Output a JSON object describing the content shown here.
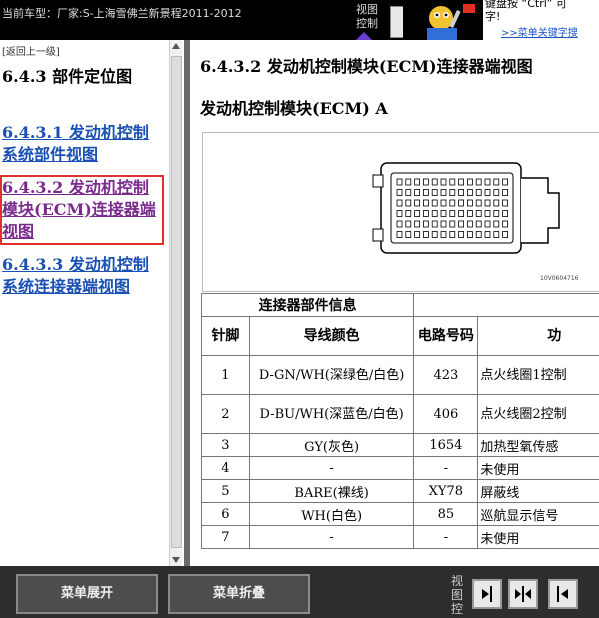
{
  "topbar": {
    "car_label": "当前车型：厂家:S-上海雪佛兰新景程2011-2012",
    "view_control": "视图控制",
    "help_line1": "键盘按 “Ctrl” 可",
    "help_line2": "字!",
    "help_link": ">>菜单关键字搜"
  },
  "left": {
    "back": "[返回上一级]",
    "section_title": "6.4.3 部件定位图",
    "links": [
      {
        "label": "6.4.3.1 发动机控制系统部件视图"
      },
      {
        "label": "6.4.3.2 发动机控制模块(ECM)连接器端视图"
      },
      {
        "label": "6.4.3.3 发动机控制系统连接器端视图"
      }
    ]
  },
  "content": {
    "heading": "6.4.3.2 发动机控制模块(ECM)连接器端视图",
    "subheading": "发动机控制模块(ECM) A",
    "figure_code": "10V0604716",
    "table": {
      "caption": "连接器部件信息",
      "headers": [
        "针脚",
        "导线颜色",
        "电路号码",
        "功"
      ],
      "rows": [
        [
          "1",
          "D-GN/WH(深绿色/白色)",
          "423",
          "点火线圈1控制"
        ],
        [
          "2",
          "D-BU/WH(深蓝色/白色)",
          "406",
          "点火线圈2控制"
        ],
        [
          "3",
          "GY(灰色)",
          "1654",
          "加热型氧传感"
        ],
        [
          "4",
          "-",
          "-",
          "未使用"
        ],
        [
          "5",
          "BARE(裸线)",
          "XY78",
          "屏蔽线"
        ],
        [
          "6",
          "WH(白色)",
          "85",
          "巡航显示信号"
        ],
        [
          "7",
          "-",
          "-",
          "未使用"
        ]
      ]
    }
  },
  "bottom": {
    "expand_label": "菜单展开",
    "collapse_label": "菜单折叠",
    "view_control": "视图控"
  },
  "colors": {
    "link": "#1a4fb3",
    "active_link": "#7a2a8c",
    "active_outline": "#e03030"
  }
}
